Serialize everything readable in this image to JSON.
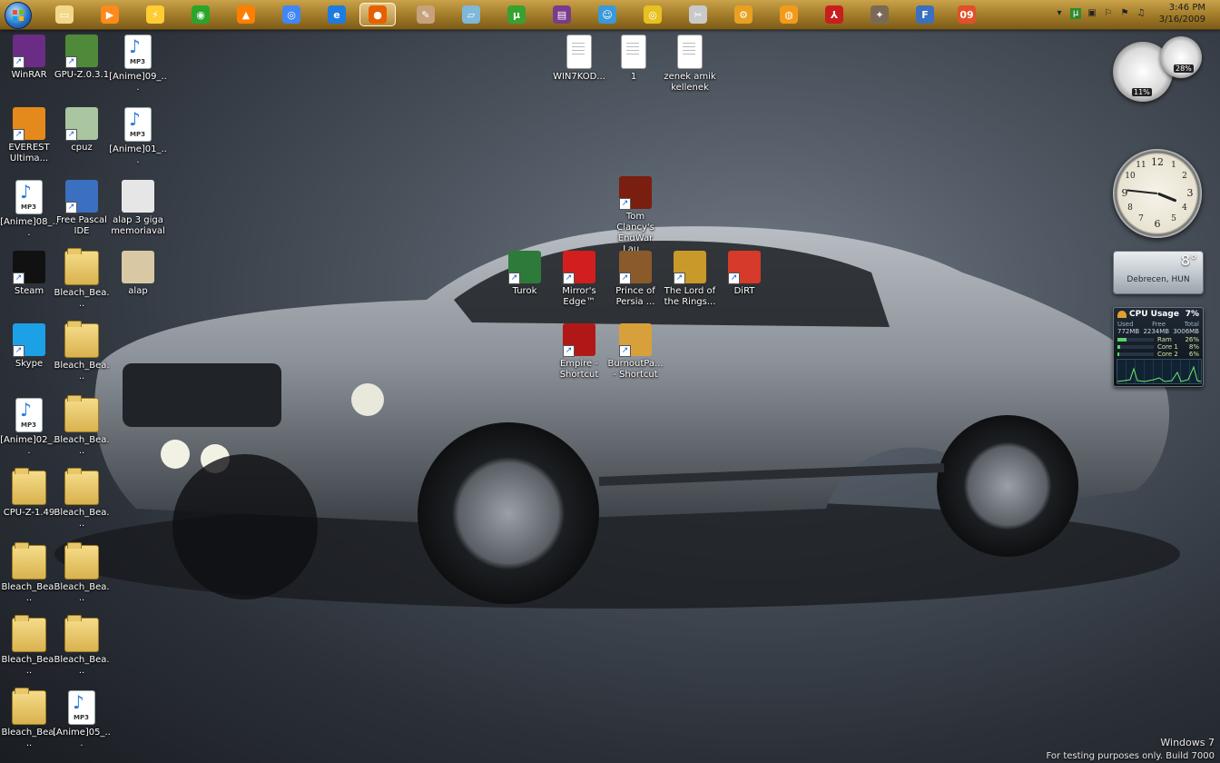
{
  "taskbar": {
    "pinned": [
      {
        "name": "explorer-icon",
        "color": "#f3d88a",
        "glyph": "▭"
      },
      {
        "name": "media-player-icon",
        "color": "#ff8a1c",
        "glyph": "▶"
      },
      {
        "name": "winamp-icon",
        "color": "#ffcc33",
        "glyph": "⚡"
      },
      {
        "name": "windows-media-icon",
        "color": "#2aa52a",
        "glyph": "◉"
      },
      {
        "name": "vlc-icon",
        "color": "#ff7f00",
        "glyph": "▲"
      },
      {
        "name": "chrome-icon",
        "color": "#4285f4",
        "glyph": "◎"
      },
      {
        "name": "ie-icon",
        "color": "#1e7be0",
        "glyph": "e"
      },
      {
        "name": "firefox-icon",
        "color": "#e66000",
        "glyph": "●"
      },
      {
        "name": "paint-icon",
        "color": "#c7a17a",
        "glyph": "✎"
      },
      {
        "name": "notepad-icon",
        "color": "#7fb8d8",
        "glyph": "▱"
      },
      {
        "name": "utorrent-icon",
        "color": "#37a22f",
        "glyph": "µ"
      },
      {
        "name": "winrar-icon",
        "color": "#7a3b8c",
        "glyph": "▤"
      },
      {
        "name": "messenger-icon",
        "color": "#3a9ad9",
        "glyph": "☺"
      },
      {
        "name": "dvd-icon",
        "color": "#e8c020",
        "glyph": "◎"
      },
      {
        "name": "tools-icon",
        "color": "#c9c9c9",
        "glyph": "✂"
      },
      {
        "name": "settings-icon",
        "color": "#e8a020",
        "glyph": "⚙"
      },
      {
        "name": "rss-icon",
        "color": "#f29a1a",
        "glyph": "◍"
      },
      {
        "name": "acrobat-icon",
        "color": "#c81e1e",
        "glyph": "⅄"
      },
      {
        "name": "gimp-icon",
        "color": "#7a6a55",
        "glyph": "✦"
      },
      {
        "name": "fpc-icon",
        "color": "#3b6fc0",
        "glyph": "F"
      },
      {
        "name": "badge-09-icon",
        "color": "#e2502a",
        "glyph": "09"
      }
    ],
    "clock": {
      "time": "3:46 PM",
      "date": "3/16/2009"
    }
  },
  "desktop": {
    "icons": [
      {
        "name": "winrar",
        "label": "WinRAR",
        "type": "app",
        "color": "#6b2c86",
        "shortcut": true
      },
      {
        "name": "gpu-z",
        "label": "GPU-Z.0.3.1",
        "type": "app",
        "color": "#4f8a3a",
        "shortcut": true
      },
      {
        "name": "anime09",
        "label": "[Anime]09_...",
        "type": "mp3"
      },
      {
        "name": "everest",
        "label": "EVEREST Ultima...",
        "type": "app",
        "color": "#e48a1c",
        "shortcut": true
      },
      {
        "name": "cpuz",
        "label": "cpuz",
        "type": "app",
        "color": "#a9c6a0",
        "shortcut": true
      },
      {
        "name": "anime01",
        "label": "[Anime]01_...",
        "type": "mp3"
      },
      {
        "name": "anime08",
        "label": "[Anime]08_...",
        "type": "mp3"
      },
      {
        "name": "free-pascal",
        "label": "Free Pascal IDE",
        "type": "app",
        "color": "#3b6fc0",
        "shortcut": true
      },
      {
        "name": "alap-3-giga",
        "label": "alap 3 giga memoriaval",
        "type": "app",
        "color": "#e6e6e6"
      },
      {
        "name": "steam",
        "label": "Steam",
        "type": "app",
        "color": "#111111",
        "shortcut": true
      },
      {
        "name": "bleach-1",
        "label": "Bleach_Bea...",
        "type": "folder"
      },
      {
        "name": "alap",
        "label": "alap",
        "type": "app",
        "color": "#d8c9a4"
      },
      {
        "name": "skype",
        "label": "Skype",
        "type": "app",
        "color": "#1da1e6",
        "shortcut": true
      },
      {
        "name": "bleach-2",
        "label": "Bleach_Bea...",
        "type": "folder"
      },
      {
        "name": "anime02",
        "label": "[Anime]02_...",
        "type": "mp3"
      },
      {
        "name": "bleach-3",
        "label": "Bleach_Bea...",
        "type": "folder"
      },
      {
        "name": "cpu-z-149",
        "label": "CPU-Z-1.49",
        "type": "folder"
      },
      {
        "name": "bleach-4",
        "label": "Bleach_Bea...",
        "type": "folder"
      },
      {
        "name": "bleach-5",
        "label": "Bleach_Bea...",
        "type": "folder"
      },
      {
        "name": "bleach-6",
        "label": "Bleach_Bea...",
        "type": "folder"
      },
      {
        "name": "bleach-7",
        "label": "Bleach_Bea...",
        "type": "folder"
      },
      {
        "name": "bleach-8",
        "label": "Bleach_Bea...",
        "type": "folder"
      },
      {
        "name": "bleach-9",
        "label": "Bleach_Bea...",
        "type": "folder"
      },
      {
        "name": "anime05",
        "label": "[Anime]05_...",
        "type": "mp3"
      },
      {
        "name": "win7kod",
        "label": "WIN7KOD...",
        "type": "doc"
      },
      {
        "name": "doc-1",
        "label": "1",
        "type": "doc"
      },
      {
        "name": "zenek",
        "label": "zenek amik kellenek",
        "type": "doc"
      },
      {
        "name": "endwar",
        "label": "Tom Clancy's EndWar Lau...",
        "type": "app",
        "color": "#7a1e10",
        "shortcut": true
      },
      {
        "name": "turok",
        "label": "Turok",
        "type": "app",
        "color": "#2e7a3a",
        "shortcut": true
      },
      {
        "name": "mirrors-edge",
        "label": "Mirror's Edge™",
        "type": "app",
        "color": "#d21e1e",
        "shortcut": true
      },
      {
        "name": "prince-of-persia",
        "label": "Prince of Persia ...",
        "type": "app",
        "color": "#8a5a2a",
        "shortcut": true
      },
      {
        "name": "lord-of-rings",
        "label": "The Lord of the Rings...",
        "type": "app",
        "color": "#c99a2a",
        "shortcut": true
      },
      {
        "name": "dirt",
        "label": "DiRT",
        "type": "app",
        "color": "#d63a2a",
        "shortcut": true
      },
      {
        "name": "empire",
        "label": "Empire - Shortcut",
        "type": "app",
        "color": "#b01818",
        "shortcut": true
      },
      {
        "name": "burnout",
        "label": "BurnoutPa... - Shortcut",
        "type": "app",
        "color": "#d8a03a",
        "shortcut": true
      }
    ]
  },
  "gadgets": {
    "meter": {
      "cpu": "11%",
      "ram": "28%"
    },
    "weather": {
      "temperature": "8°",
      "city": "Debrecen, HUN"
    },
    "cpu_usage": {
      "title": "CPU Usage",
      "total_pct": "7%",
      "headers": [
        "Used",
        "Free",
        "Total"
      ],
      "values": [
        "772MB",
        "2234MB",
        "3006MB"
      ],
      "rows": [
        {
          "label": "Ram",
          "value": "26%",
          "level": 0.26
        },
        {
          "label": "Core 1",
          "value": "8%",
          "level": 0.08
        },
        {
          "label": "Core 2",
          "value": "6%",
          "level": 0.06
        }
      ]
    }
  },
  "watermark": {
    "line1": "Windows 7",
    "line2": "For testing purposes only. Build 7000"
  }
}
